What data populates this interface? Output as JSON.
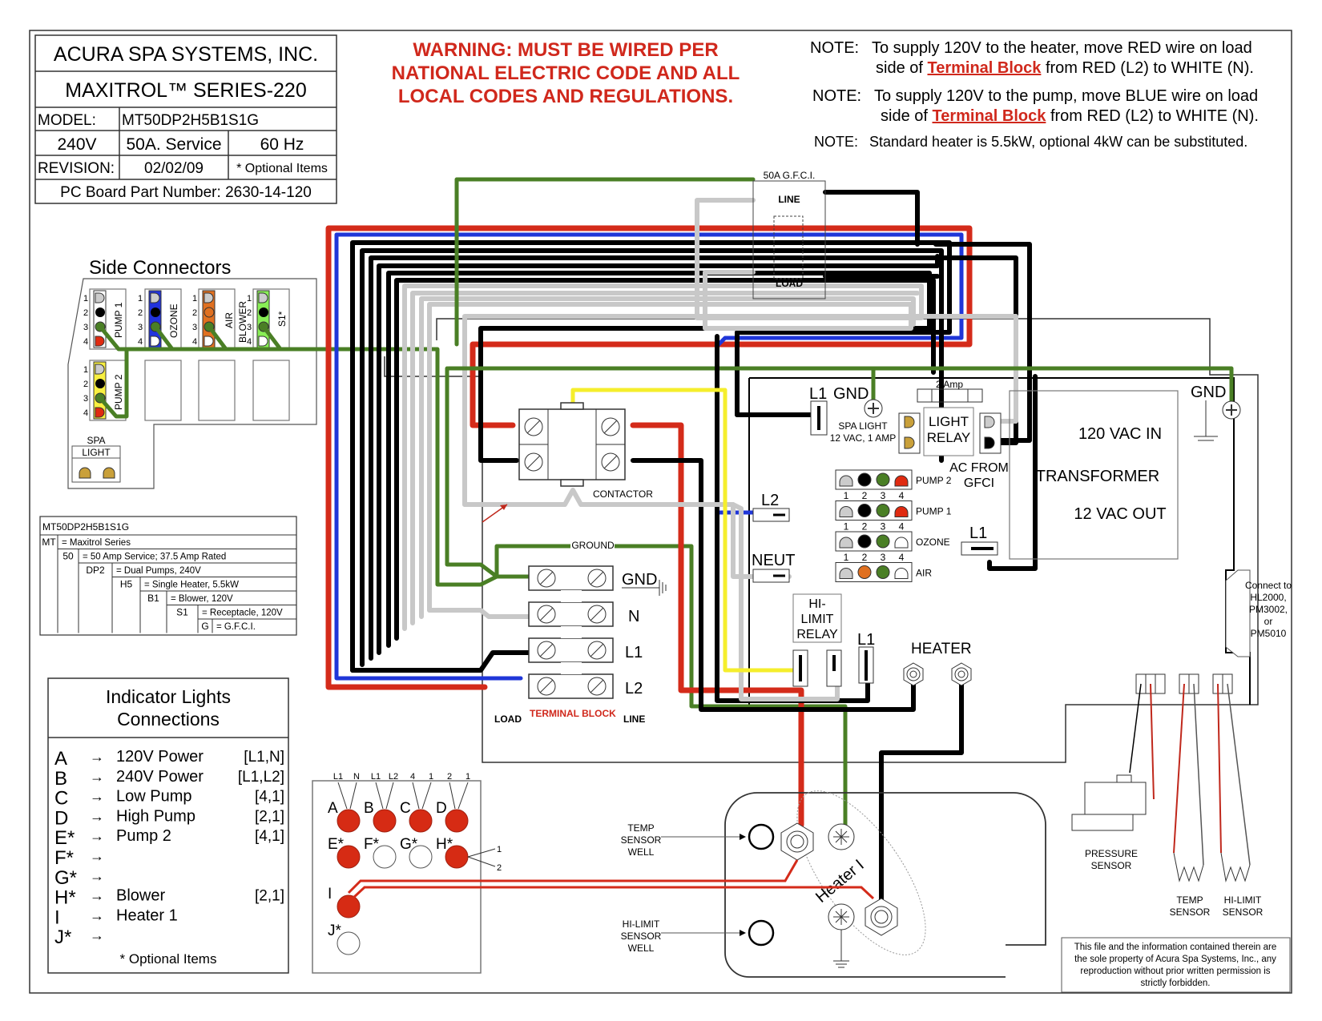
{
  "title_block": {
    "company": "ACURA SPA SYSTEMS, INC.",
    "series": "MAXITROL™ SERIES-220",
    "model_label": "MODEL:",
    "model_value": "MT50DP2H5B1S1G",
    "voltage": "240V",
    "service": "50A. Service",
    "frequency": "60 Hz",
    "revision_label": "REVISION:",
    "revision_value": "02/02/09",
    "optional_note": "* Optional Items",
    "pcb_part": "PC Board Part Number: 2630-14-120"
  },
  "warning": {
    "lines": [
      "WARNING:  MUST BE WIRED PER",
      "NATIONAL ELECTRIC CODE AND ALL",
      "LOCAL CODES AND REGULATIONS."
    ],
    "color": "#d0281c"
  },
  "notes": [
    {
      "prefix": "NOTE:",
      "line1": "To supply 120V to the heater, move RED wire on load",
      "line2_pre": "side of ",
      "link": "Terminal Block",
      "line2_post": " from RED (L2) to WHITE (N)."
    },
    {
      "prefix": "NOTE:",
      "line1": "To supply 120V to the pump, move BLUE wire on load",
      "line2_pre": "side of ",
      "link": "Terminal Block",
      "line2_post": " from RED (L2) to WHITE (N)."
    },
    {
      "prefix": "NOTE:",
      "line1": "Standard heater is 5.5kW, optional 4kW can be substituted."
    }
  ],
  "side_connectors": {
    "title": "Side Connectors",
    "pin_numbers": [
      "1",
      "2",
      "3",
      "4"
    ],
    "connectors": [
      {
        "label": "PUMP 1",
        "color": "#ffffff"
      },
      {
        "label": "OZONE",
        "color": "#2233dd"
      },
      {
        "label": "AIR BLOWER",
        "label_line1": "AIR",
        "label_line2": "BLOWER",
        "color": "#e07020"
      },
      {
        "label": "S1*",
        "color": "#88ee55"
      },
      {
        "label": "PUMP 2",
        "color": "#f8ef40"
      }
    ],
    "spa_light_line1": "SPA",
    "spa_light_line2": "LIGHT"
  },
  "model_decode": {
    "header": "MT50DP2H5B1S1G",
    "rows": [
      {
        "code": "MT",
        "desc": "= Maxitrol Series"
      },
      {
        "code": "50",
        "desc": "=  50 Amp Service; 37.5 Amp Rated"
      },
      {
        "code": "DP2",
        "desc": "=  Dual Pumps, 240V"
      },
      {
        "code": "H5",
        "desc": "=  Single Heater, 5.5kW"
      },
      {
        "code": "B1",
        "desc": "=  Blower, 120V"
      },
      {
        "code": "S1",
        "desc": "=  Receptacle, 120V"
      },
      {
        "code": "G",
        "desc": "=  G.F.C.I."
      }
    ]
  },
  "indicator_lights": {
    "title_line1": "Indicator Lights",
    "title_line2": "Connections",
    "arrow": "→",
    "rows": [
      {
        "letter": "A",
        "desc": "120V Power",
        "pins": "[L1,N]"
      },
      {
        "letter": "B",
        "desc": "240V Power",
        "pins": "[L1,L2]"
      },
      {
        "letter": "C",
        "desc": "Low Pump",
        "pins": "[4,1]"
      },
      {
        "letter": "D",
        "desc": "High Pump",
        "pins": "[2,1]"
      },
      {
        "letter": "E*",
        "desc": "Pump 2",
        "pins": "[4,1]"
      },
      {
        "letter": "F*",
        "desc": "",
        "pins": ""
      },
      {
        "letter": "G*",
        "desc": "",
        "pins": ""
      },
      {
        "letter": "H*",
        "desc": "Blower",
        "pins": "[2,1]"
      },
      {
        "letter": "I",
        "desc": "Heater 1",
        "pins": ""
      },
      {
        "letter": "J*",
        "desc": "",
        "pins": ""
      }
    ],
    "footer": "* Optional Items"
  },
  "led_panel": {
    "top_labels": [
      "L1",
      "N",
      "L1",
      "L2",
      "4",
      "1",
      "2",
      "1"
    ],
    "lights": [
      {
        "letter": "A",
        "lit": true
      },
      {
        "letter": "B",
        "lit": true
      },
      {
        "letter": "C",
        "lit": true
      },
      {
        "letter": "D",
        "lit": true
      },
      {
        "letter": "E*",
        "lit": true
      },
      {
        "letter": "F*",
        "lit": false
      },
      {
        "letter": "G*",
        "lit": false
      },
      {
        "letter": "H*",
        "lit": true
      },
      {
        "letter": "I",
        "lit": true
      },
      {
        "letter": "J*",
        "lit": false
      }
    ],
    "side_labels": [
      "1",
      "2"
    ]
  },
  "gfci": {
    "title": "50A G.F.C.I.",
    "line": "LINE",
    "load": "LOAD"
  },
  "contactor": {
    "label": "CONTACTOR"
  },
  "terminal_block": {
    "ground_label": "GROUND",
    "rows": [
      "GND",
      "N",
      "L1",
      "L2"
    ],
    "load": "LOAD",
    "name": "TERMINAL BLOCK",
    "line": "LINE"
  },
  "board": {
    "l1_top": "L1",
    "gnd": "GND",
    "spa_light_line1": "SPA LIGHT",
    "spa_light_line2": "12 VAC, 1 AMP",
    "fuse": "2 Amp",
    "light_relay_line1": "LIGHT",
    "light_relay_line2": "RELAY",
    "ac_from_line1": "AC FROM",
    "ac_from_line2": "GFCI",
    "transformer_in": "120 VAC IN",
    "transformer": "TRANSFORMER",
    "transformer_out": "12 VAC OUT",
    "gnd_right": "GND",
    "l2": "L2",
    "neut": "NEUT",
    "l1_mid": "L1",
    "hilimit_line1": "HI-",
    "hilimit_line2": "LIMIT",
    "hilimit_line3": "RELAY",
    "l1_bottom": "L1",
    "heater": "HEATER",
    "header_pins": [
      "1",
      "2",
      "3",
      "4"
    ],
    "headers": [
      {
        "label": "PUMP 2",
        "pins": [
          "#cccccc",
          "#000000",
          "#4a7f25",
          "#e02a10"
        ]
      },
      {
        "label": "PUMP 1",
        "pins": [
          "#cccccc",
          "#000000",
          "#4a7f25",
          "#e02a10"
        ]
      },
      {
        "label": "OZONE",
        "pins": [
          "#cccccc",
          "#000000",
          "#4a7f25",
          "#ffffff"
        ]
      },
      {
        "label": "AIR",
        "pins": [
          "#cccccc",
          "#e07020",
          "#4a7f25",
          "#ffffff"
        ]
      }
    ],
    "connect_to_lines": [
      "Connect to",
      "HL2000,",
      "PM3002,",
      "or",
      "PM5010"
    ]
  },
  "heater_assembly": {
    "temp_well_line1": "TEMP",
    "temp_well_line2": "SENSOR",
    "temp_well_line3": "WELL",
    "hilimit_well_line1": "HI-LIMIT",
    "hilimit_well_line2": "SENSOR",
    "hilimit_well_line3": "WELL",
    "heater_name": "Heater I"
  },
  "sensors": {
    "pressure_line1": "PRESSURE",
    "pressure_line2": "SENSOR",
    "temp_line1": "TEMP",
    "temp_line2": "SENSOR",
    "hilimit_line1": "HI-LIMIT",
    "hilimit_line2": "SENSOR"
  },
  "copyright": {
    "lines": [
      "This file and the information contained therein are",
      "the sole property of Acura Spa Systems, Inc., any",
      "reproduction without prior written permission is",
      "strictly forbidden."
    ]
  },
  "wire_colors": {
    "red": "#d42b1a",
    "blue": "#1f36d8",
    "black": "#000000",
    "green": "#4a7f25",
    "white": "#c8c8c8",
    "yellow": "#f5ee2c"
  }
}
